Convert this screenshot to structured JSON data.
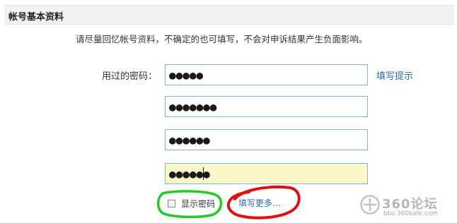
{
  "section": {
    "title": "帐号基本资料"
  },
  "instruction": "请尽量回忆帐号资料，不确定的也可填写，不会对申诉结果产生负面影响。",
  "password": {
    "label": "用过的密码：",
    "hint_link": "填写提示",
    "fields": [
      "●●●●●",
      "●●●●●●●",
      "●●●●●●",
      "●●●●●●"
    ]
  },
  "show_password": {
    "label": "显示密码",
    "checked": false
  },
  "more_link": "填写更多…",
  "annotations": {
    "green_circle_color": "#22cc22",
    "red_circle_color": "#e01010"
  },
  "watermark": {
    "brand": "360论坛",
    "url": "bbs.360safe.com"
  }
}
